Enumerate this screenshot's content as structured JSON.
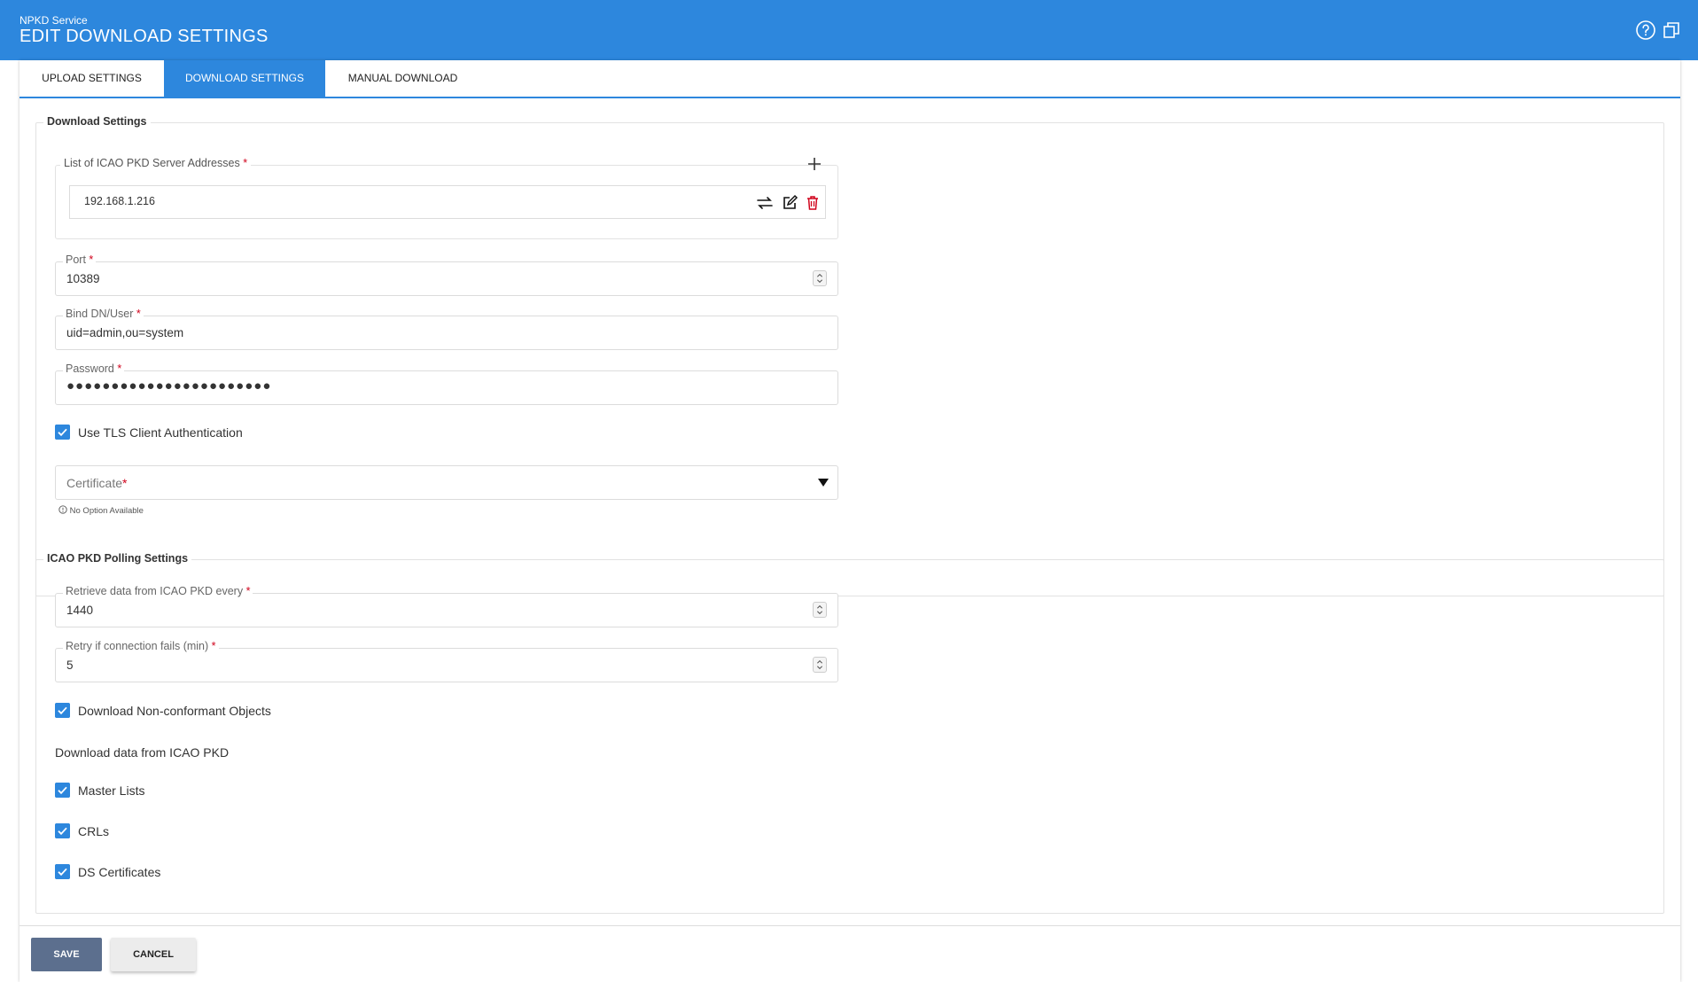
{
  "header": {
    "service": "NPKD Service",
    "title": "EDIT DOWNLOAD SETTINGS",
    "help_icon": "help-circle-icon",
    "window_icon": "window-restore-icon",
    "bg_color": "#2d87dd"
  },
  "tabs": [
    {
      "label": "UPLOAD SETTINGS",
      "active": false
    },
    {
      "label": "DOWNLOAD SETTINGS",
      "active": true
    },
    {
      "label": "MANUAL DOWNLOAD",
      "active": false
    }
  ],
  "download_settings": {
    "title": "Download Settings",
    "servers": {
      "legend": "List of ICAO PKD Server Addresses",
      "required": "*",
      "items": [
        {
          "address": "192.168.1.216"
        }
      ]
    },
    "port": {
      "label": "Port",
      "required": "*",
      "value": "10389"
    },
    "bind_dn": {
      "label": "Bind DN/User",
      "required": "*",
      "value": "uid=admin,ou=system"
    },
    "password": {
      "label": "Password",
      "required": "*",
      "value": "●●●●●●●●●●●●●●●●●●●●●●●"
    },
    "tls": {
      "label": "Use TLS Client Authentication",
      "checked": true
    },
    "certificate": {
      "placeholder": "Certificate",
      "required": "*",
      "hint": "No Option Available"
    }
  },
  "polling_settings": {
    "title": "ICAO PKD Polling Settings",
    "retrieve": {
      "label": "Retrieve data from ICAO PKD every",
      "required": "*",
      "value": "1440"
    },
    "retry": {
      "label": "Retry if connection fails (min)",
      "required": "*",
      "value": "5"
    },
    "non_conformant": {
      "label": "Download Non-conformant Objects",
      "checked": true
    },
    "download_label": "Download data from ICAO PKD",
    "master_lists": {
      "label": "Master Lists",
      "checked": true
    },
    "crls": {
      "label": "CRLs",
      "checked": true
    },
    "ds_certs": {
      "label": "DS Certificates",
      "checked": true
    }
  },
  "footer": {
    "save": "SAVE",
    "cancel": "CANCEL"
  }
}
